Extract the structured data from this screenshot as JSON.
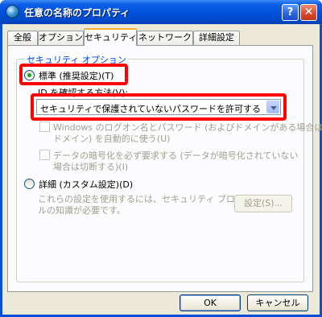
{
  "window": {
    "title": "任意の名称のプロパティ",
    "help_button": "?",
    "close_button": "✕"
  },
  "tabs": [
    {
      "label": "全般"
    },
    {
      "label": "オプション"
    },
    {
      "label": "セキュリティ"
    },
    {
      "label": "ネットワーク"
    },
    {
      "label": "詳細設定"
    }
  ],
  "security": {
    "group_title": "セキュリティ オプション",
    "typical_label": "標準 (推奨設定)(T)",
    "verify_label": "ID を確認する方法(V):",
    "verify_value": "セキュリティで保護されていないパスワードを許可する",
    "logon_line1": "Windows のログオン名とパスワード (およびドメインがある場合は",
    "logon_line2": "ドメイン) を自動的に使う(U)",
    "encrypt_line1": "データの暗号化を必ず要求する (データが暗号化されていない",
    "encrypt_line2": "場合は切断する)(I)",
    "advanced_label": "詳細 (カスタム設定)(D)",
    "advanced_desc1": "これらの設定を使用するには、セキュリティ プロトコ",
    "advanced_desc2": "ルの知識が必要です。",
    "settings_button": "設定(S)..."
  },
  "footer": {
    "ok": "OK",
    "cancel": "キャンセル"
  },
  "colors": {
    "highlight": "#ff0000",
    "titlebar": "#0052dc",
    "group_title": "#0046d5"
  }
}
